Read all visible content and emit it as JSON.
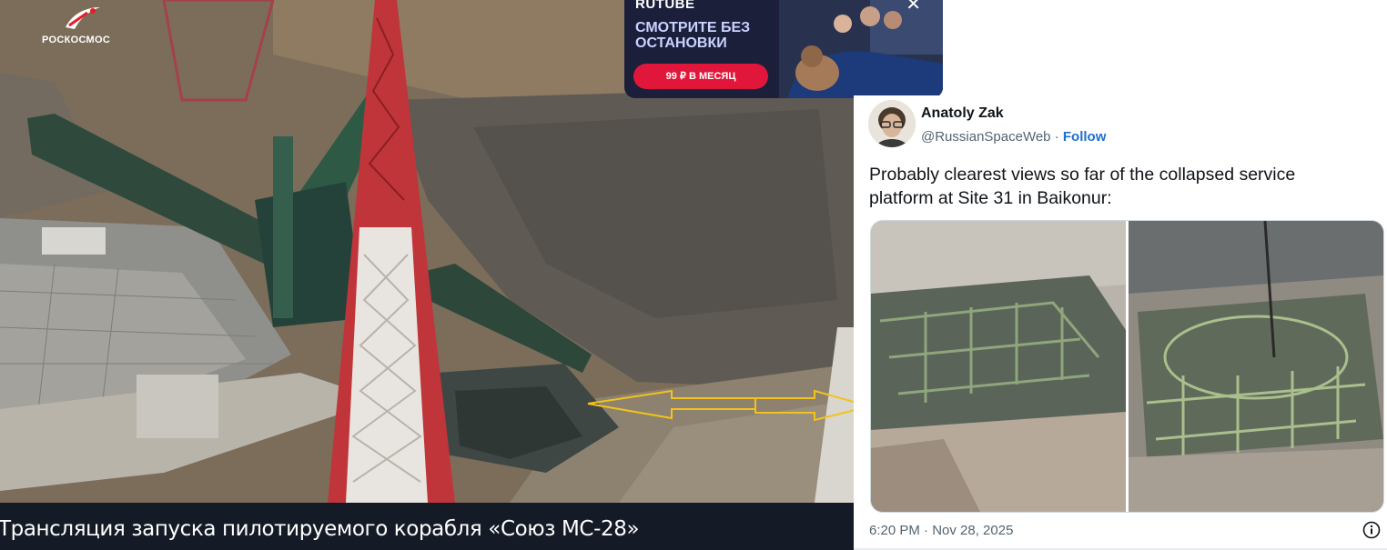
{
  "video": {
    "channel_logo_text": "РОСКОСМОС",
    "caption": "Трансляция запуска пилотируемого корабля «Союз МС-28»"
  },
  "ad": {
    "brand": "RUTUBE",
    "headline": "СМОТРИТЕ БЕЗ ОСТАНОВКИ",
    "cta": "99 ₽ В МЕСЯЦ",
    "close_symbol": "✕"
  },
  "tweet": {
    "author_name": "Anatoly Zak",
    "handle": "@RussianSpaceWeb",
    "separator": "·",
    "follow_label": "Follow",
    "text": "Probably clearest views so far of the collapsed service platform at Site 31 in Baikonur:",
    "timestamp": "6:20 PM · Nov 28, 2025"
  },
  "colors": {
    "caption_bar": "#151b26",
    "ad_cta": "#e0173a",
    "follow_link": "#1d6fd1",
    "arrow_annotation": "#f2c31c"
  },
  "icons": [
    "roscosmos-logo-icon",
    "close-icon",
    "info-icon",
    "double-arrow-annotation"
  ]
}
